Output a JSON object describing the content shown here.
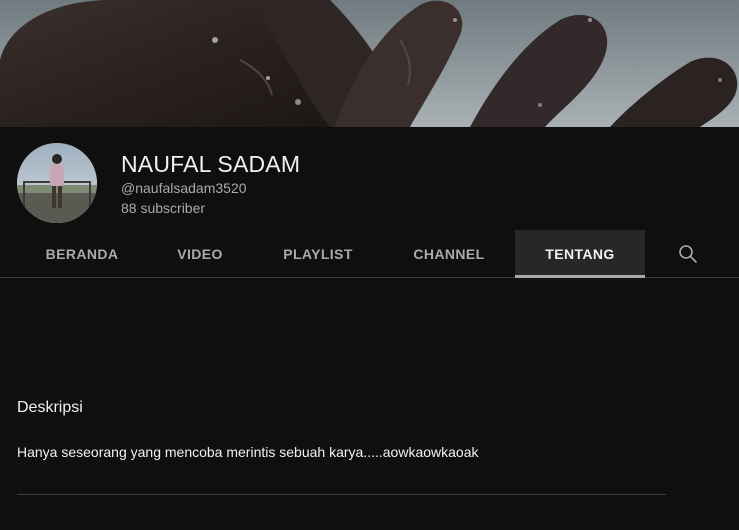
{
  "channel": {
    "name": "NAUFAL SADAM",
    "handle": "@naufalsadam3520",
    "subscribers": "88 subscriber"
  },
  "tabs": [
    {
      "label": "BERANDA",
      "active": false
    },
    {
      "label": "VIDEO",
      "active": false
    },
    {
      "label": "PLAYLIST",
      "active": false
    },
    {
      "label": "CHANNEL",
      "active": false
    },
    {
      "label": "TENTANG",
      "active": true
    }
  ],
  "search_icon": "search-icon",
  "about": {
    "heading": "Deskripsi",
    "description": "Hanya seseorang yang mencoba merintis sebuah karya.....aowkaowkaoak"
  },
  "colors": {
    "background": "#0f0f0f",
    "active_tab_bg": "#272727",
    "text_primary": "#f1f1f1",
    "text_secondary": "#aaaaaa",
    "divider": "#3d3d3d"
  }
}
